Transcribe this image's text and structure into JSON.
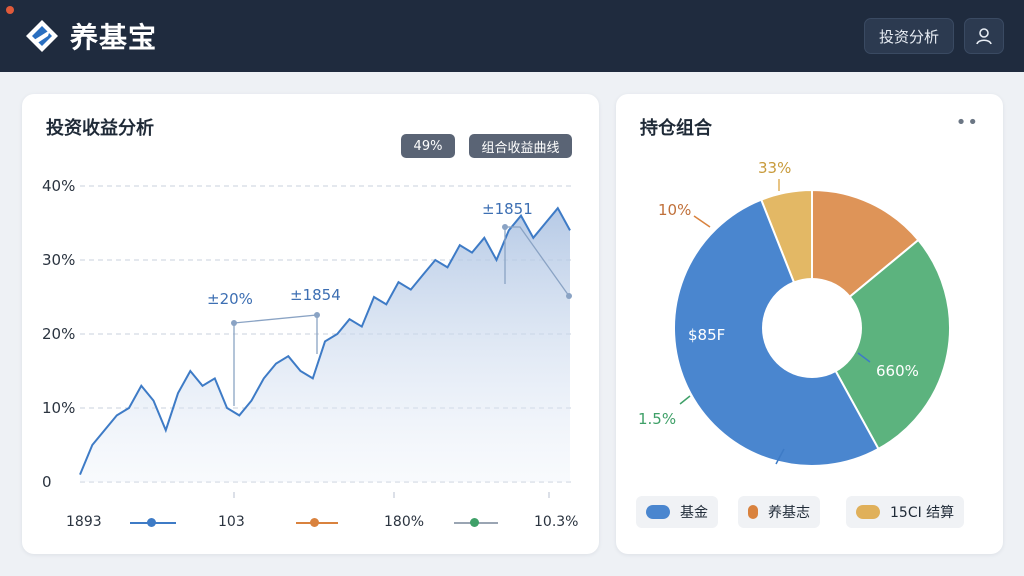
{
  "header": {
    "app_title": "养基宝",
    "analysis_button": "投资分析",
    "logo_icon": "diamond-logo-icon",
    "user_icon": "user-icon"
  },
  "left_card": {
    "title": "投资收益分析",
    "tag_percent": "49%",
    "tag_combo": "组合收益曲线",
    "annotations": [
      "±20%",
      "±1854",
      "±1851"
    ],
    "legend": {
      "left_label": "1893",
      "items": [
        "103",
        "180%",
        "10.3%"
      ]
    }
  },
  "right_card": {
    "title": "持仓组合",
    "more_icon": "more-dots-icon",
    "legend": [
      "基金",
      "养基志",
      "15CI 结算"
    ]
  },
  "chart_data": [
    {
      "type": "area",
      "yticks": [
        "40%",
        "30%",
        "20%",
        "10%",
        "0"
      ],
      "ylim": [
        0,
        40
      ],
      "series": [
        {
          "values": [
            1,
            5,
            7,
            9,
            10,
            13,
            11,
            7,
            12,
            15,
            13,
            14,
            10,
            9,
            11,
            14,
            16,
            17,
            15,
            14,
            19,
            20,
            22,
            21,
            25,
            24,
            27,
            26,
            28,
            30,
            29,
            32,
            31,
            33,
            30,
            34,
            36,
            33,
            35,
            37,
            34
          ],
          "color": "#3e7bc6"
        }
      ]
    },
    {
      "type": "pie",
      "labels": [
        "33%",
        "10%",
        "$85F",
        "1.5%",
        "660%"
      ],
      "values": [
        6,
        14,
        28,
        52
      ],
      "colors": [
        "#e3b865",
        "#de9458",
        "#5cb37e",
        "#4a86cf"
      ]
    }
  ],
  "colors": {
    "header_bg": "#1f2b3e",
    "accent_blue": "#3e7bc6",
    "orange": "#d9823e",
    "green": "#3fa068",
    "gold": "#e0b05a"
  }
}
